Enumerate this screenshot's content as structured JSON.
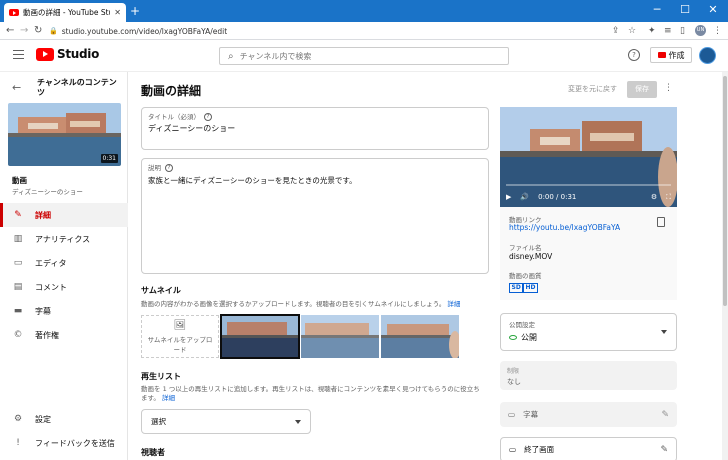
{
  "browser": {
    "tab_title": "動画の詳細 - YouTube Studio",
    "url": "studio.youtube.com/video/lxagYOBFaYA/edit"
  },
  "header": {
    "logo": "Studio",
    "search_placeholder": "チャンネル内で検索",
    "create_label": "作成"
  },
  "sidebar": {
    "title": "チャンネルのコンテンツ",
    "thumb_duration": "0:31",
    "video_label": "動画",
    "video_name": "ディズニーシーのショー",
    "items": [
      {
        "label": "詳細",
        "icon": "pencil-icon"
      },
      {
        "label": "アナリティクス",
        "icon": "analytics-icon"
      },
      {
        "label": "エディタ",
        "icon": "editor-icon"
      },
      {
        "label": "コメント",
        "icon": "comment-icon"
      },
      {
        "label": "字幕",
        "icon": "subtitles-icon"
      },
      {
        "label": "著作権",
        "icon": "copyright-icon"
      }
    ],
    "settings": "設定",
    "feedback": "フィードバックを送信"
  },
  "main": {
    "page_title": "動画の詳細",
    "undo": "変更を元に戻す",
    "save": "保存",
    "title_label": "タイトル（必須）",
    "title_value": "ディズニーシーのショー",
    "desc_label": "説明",
    "desc_value": "家族と一緒にディズニーシーのショーを見たときの光景です。",
    "thumb_heading": "サムネイル",
    "thumb_desc": "動画の内容がわかる画像を選択するかアップロードします。視聴者の目を引くサムネイルにしましょう。",
    "thumb_help": "詳細",
    "upload_thumb": "サムネイルをアップロード",
    "playlist_heading": "再生リスト",
    "playlist_desc": "動画を 1 つ以上の再生リストに追加します。再生リストは、視聴者にコンテンツを素早く見つけてもらうのに役立ちます。",
    "playlist_help": "詳細",
    "playlist_select": "選択",
    "rights_heading": "視聴者"
  },
  "right": {
    "time": "0:00 / 0:31",
    "video_link_label": "動画リンク",
    "video_link": "https://youtu.be/lxagYOBFaYA",
    "filename_label": "ファイル名",
    "filename": "disney.MOV",
    "quality_label": "動画の画質",
    "quality_sd": "SD",
    "quality_hd": "HD",
    "visibility_label": "公開設定",
    "visibility_value": "公開",
    "restrictions_label": "制限",
    "restrictions_value": "なし",
    "subtitles": "字幕",
    "end_screen": "終了画面"
  }
}
